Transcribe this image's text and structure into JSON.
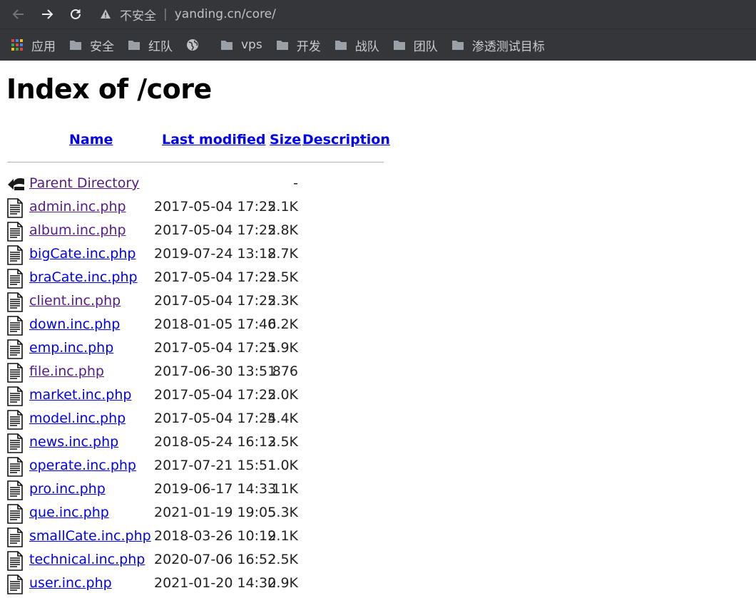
{
  "browser": {
    "security_label": "不安全",
    "separator": "|",
    "url": "yanding.cn/core/"
  },
  "bookmarks": [
    {
      "label": "应用",
      "icon": "apps-grid-icon"
    },
    {
      "label": "安全",
      "icon": "folder-icon"
    },
    {
      "label": "红队",
      "icon": "folder-icon"
    },
    {
      "label": "",
      "icon": "globe-icon"
    },
    {
      "label": "vps",
      "icon": "folder-icon"
    },
    {
      "label": "开发",
      "icon": "folder-icon"
    },
    {
      "label": "战队",
      "icon": "folder-icon"
    },
    {
      "label": "团队",
      "icon": "folder-icon"
    },
    {
      "label": "渗透测试目标",
      "icon": "folder-icon"
    }
  ],
  "page": {
    "title": "Index of /core",
    "headers": {
      "name": "Name",
      "last_modified": "Last modified",
      "size": "Size",
      "description": "Description"
    },
    "parent": {
      "name": "Parent Directory",
      "size": "-"
    },
    "files": [
      {
        "name": "admin.inc.php",
        "modified": "2017-05-04 17:25",
        "size": "2.1K",
        "visited": true
      },
      {
        "name": "album.inc.php",
        "modified": "2017-05-04 17:25",
        "size": "2.8K",
        "visited": true
      },
      {
        "name": "bigCate.inc.php",
        "modified": "2019-07-24 13:18",
        "size": "2.7K",
        "visited": false
      },
      {
        "name": "braCate.inc.php",
        "modified": "2017-05-04 17:25",
        "size": "2.5K",
        "visited": false
      },
      {
        "name": "client.inc.php",
        "modified": "2017-05-04 17:25",
        "size": "2.3K",
        "visited": true
      },
      {
        "name": "down.inc.php",
        "modified": "2018-01-05 17:40",
        "size": "6.2K",
        "visited": false
      },
      {
        "name": "emp.inc.php",
        "modified": "2017-05-04 17:25",
        "size": "1.9K",
        "visited": false
      },
      {
        "name": "file.inc.php",
        "modified": "2017-06-30 13:51",
        "size": "876",
        "visited": true
      },
      {
        "name": "market.inc.php",
        "modified": "2017-05-04 17:25",
        "size": "2.0K",
        "visited": false
      },
      {
        "name": "model.inc.php",
        "modified": "2017-05-04 17:25",
        "size": "4.4K",
        "visited": false
      },
      {
        "name": "news.inc.php",
        "modified": "2018-05-24 16:13",
        "size": "2.5K",
        "visited": false
      },
      {
        "name": "operate.inc.php",
        "modified": "2017-07-21 15:51",
        "size": "1.0K",
        "visited": false
      },
      {
        "name": "pro.inc.php",
        "modified": "2019-06-17 14:33",
        "size": "11K",
        "visited": false
      },
      {
        "name": "que.inc.php",
        "modified": "2021-01-19 19:05",
        "size": "5.3K",
        "visited": false
      },
      {
        "name": "smallCate.inc.php",
        "modified": "2018-03-26 10:19",
        "size": "2.1K",
        "visited": false
      },
      {
        "name": "technical.inc.php",
        "modified": "2020-07-06 16:52",
        "size": "2.5K",
        "visited": false
      },
      {
        "name": "user.inc.php",
        "modified": "2021-01-20 14:30",
        "size": "2.9K",
        "visited": false
      }
    ]
  },
  "colors": {
    "chrome_bg": "#35363a",
    "link": "#0000ee",
    "visited_link": "#551a8b"
  }
}
